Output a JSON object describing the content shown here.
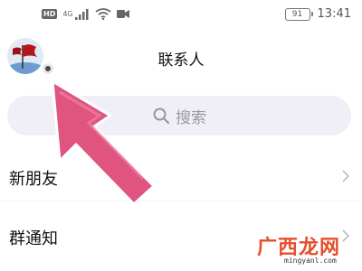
{
  "status_bar": {
    "network_badge": "HD",
    "network_type": "4G",
    "battery_level": "91",
    "time": "13:41"
  },
  "header": {
    "title": "联系人",
    "avatar_icon": "flag-avatar-icon"
  },
  "search": {
    "placeholder": "搜索",
    "icon": "search-icon"
  },
  "list": {
    "items": [
      {
        "label": "新朋友"
      },
      {
        "label": "群通知"
      }
    ]
  },
  "watermark": {
    "site_name": "广西龙网",
    "url": "mingyanl.com"
  },
  "colors": {
    "accent_pointer": "#e0557f",
    "search_bg": "#f0eef7",
    "watermark_red": "#e84d2b"
  }
}
